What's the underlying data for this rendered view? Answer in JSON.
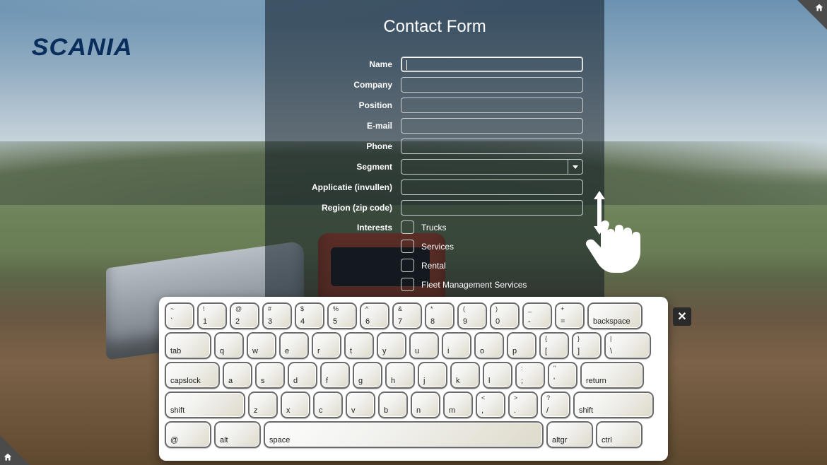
{
  "brand": "SCANIA",
  "form": {
    "title": "Contact Form",
    "fields": {
      "name": {
        "label": "Name",
        "value": ""
      },
      "company": {
        "label": "Company",
        "value": ""
      },
      "position": {
        "label": "Position",
        "value": ""
      },
      "email": {
        "label": "E-mail",
        "value": ""
      },
      "phone": {
        "label": "Phone",
        "value": ""
      },
      "segment": {
        "label": "Segment",
        "value": ""
      },
      "app": {
        "label": "Applicatie (invullen)",
        "value": ""
      },
      "region": {
        "label": "Region (zip code)",
        "value": ""
      }
    },
    "interests": {
      "label": "Interests",
      "options": [
        "Trucks",
        "Services",
        "Rental",
        "Fleet Management Services"
      ]
    }
  },
  "keyboard": {
    "close": "✕",
    "rows": [
      [
        [
          "~",
          "`"
        ],
        [
          "!",
          "1"
        ],
        [
          "@",
          "2"
        ],
        [
          "#",
          "3"
        ],
        [
          "$",
          "4"
        ],
        [
          "%",
          "5"
        ],
        [
          "^",
          "6"
        ],
        [
          "&",
          "7"
        ],
        [
          "*",
          "8"
        ],
        [
          "(",
          "9"
        ],
        [
          ")",
          "0"
        ],
        [
          "_",
          "-"
        ],
        [
          "+",
          "="
        ],
        [
          "",
          "backspace",
          "w175"
        ]
      ],
      [
        [
          "",
          "tab",
          "w15"
        ],
        [
          "",
          "q"
        ],
        [
          "",
          "w"
        ],
        [
          "",
          "e"
        ],
        [
          "",
          "r"
        ],
        [
          "",
          "t"
        ],
        [
          "",
          "y"
        ],
        [
          "",
          "u"
        ],
        [
          "",
          "i"
        ],
        [
          "",
          "o"
        ],
        [
          "",
          "p"
        ],
        [
          "{",
          "["
        ],
        [
          "}",
          "]"
        ],
        [
          "|",
          "\\",
          "w15"
        ]
      ],
      [
        [
          "",
          "capslock",
          "w175"
        ],
        [
          "",
          "a"
        ],
        [
          "",
          "s"
        ],
        [
          "",
          "d"
        ],
        [
          "",
          "f"
        ],
        [
          "",
          "g"
        ],
        [
          "",
          "h"
        ],
        [
          "",
          "j"
        ],
        [
          "",
          "k"
        ],
        [
          "",
          "l"
        ],
        [
          ":",
          ";"
        ],
        [
          "\"",
          "'"
        ],
        [
          "",
          "return",
          "w2"
        ]
      ],
      [
        [
          "",
          "shift",
          "w25"
        ],
        [
          "",
          "z"
        ],
        [
          "",
          "x"
        ],
        [
          "",
          "c"
        ],
        [
          "",
          "v"
        ],
        [
          "",
          "b"
        ],
        [
          "",
          "n"
        ],
        [
          "",
          "m"
        ],
        [
          "<",
          ","
        ],
        [
          ">",
          "."
        ],
        [
          "?",
          "/"
        ],
        [
          "",
          "shift",
          "w25"
        ]
      ],
      [
        [
          "",
          "@",
          "w15"
        ],
        [
          "",
          "alt",
          "w15"
        ],
        [
          "",
          "space",
          "wspace"
        ],
        [
          "",
          "altgr",
          "w15"
        ],
        [
          "",
          "ctrl",
          "w15"
        ]
      ]
    ]
  }
}
